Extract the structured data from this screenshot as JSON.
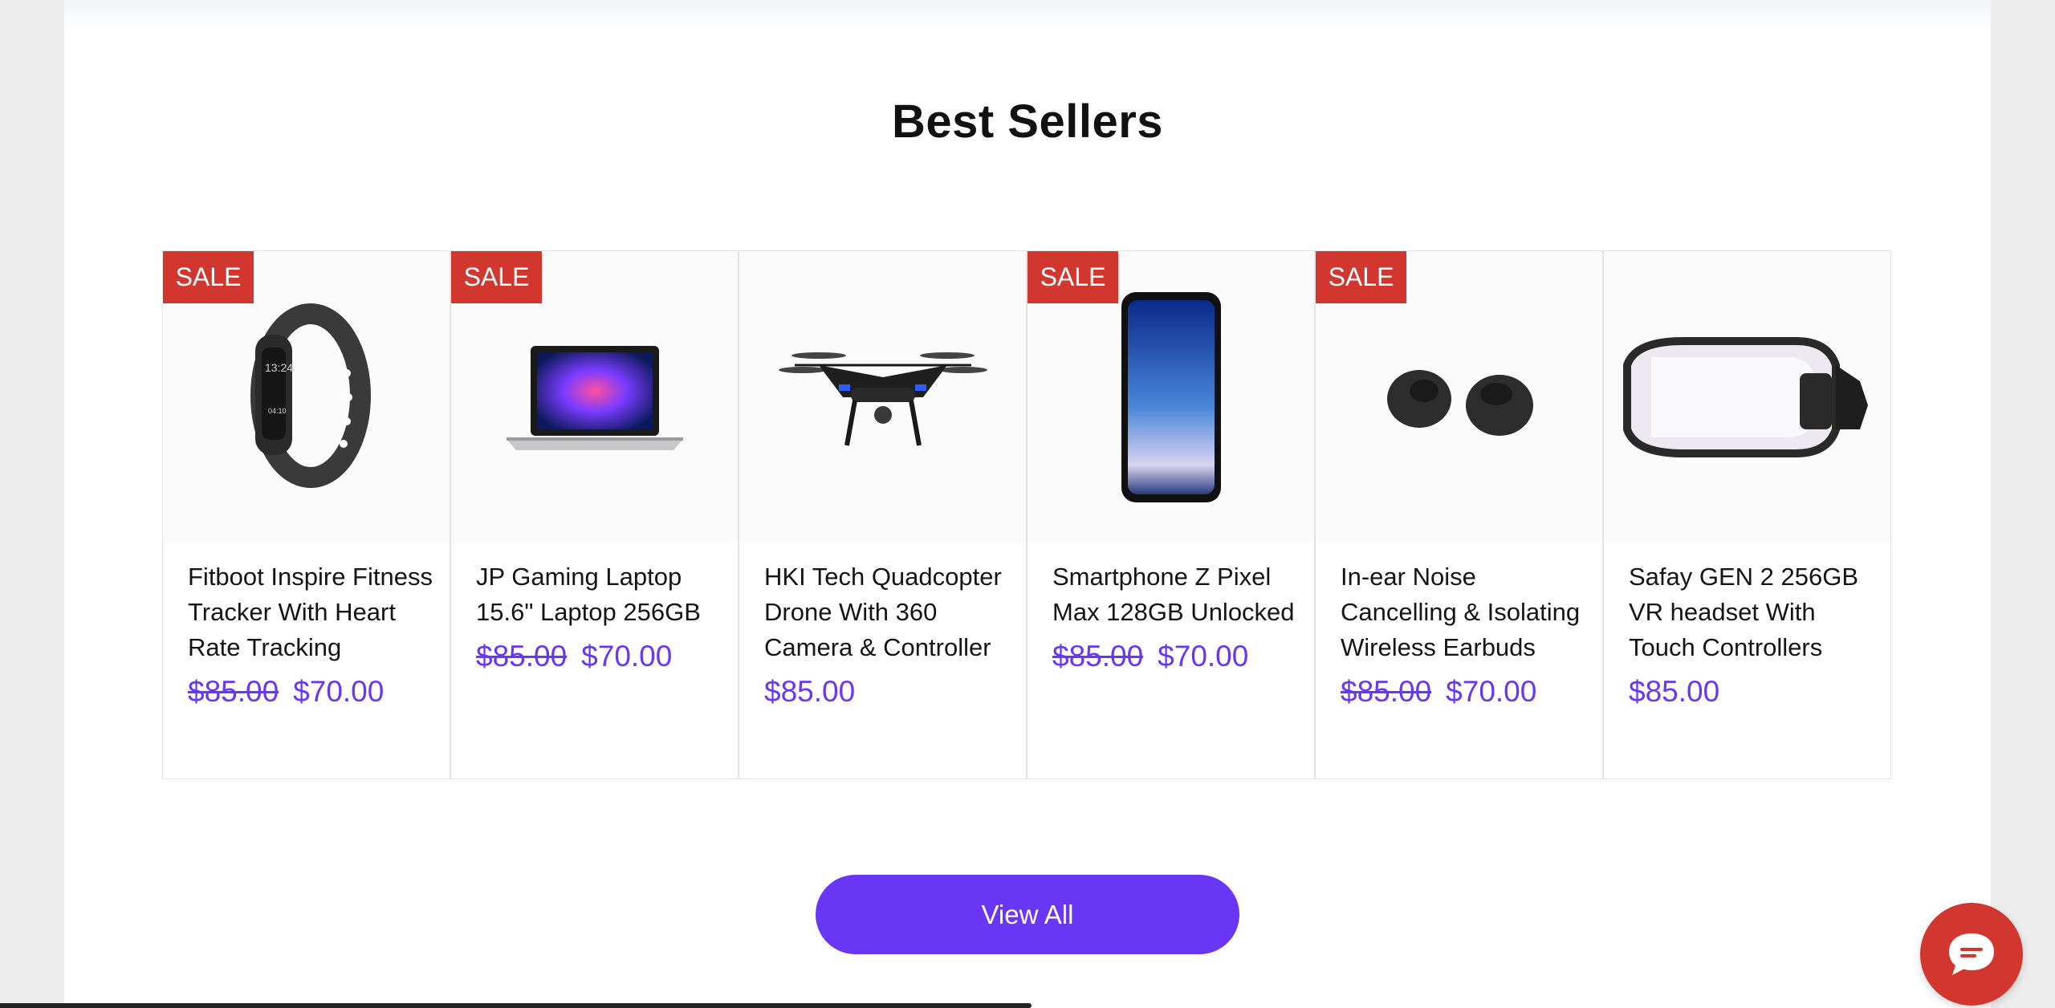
{
  "section": {
    "title": "Best Sellers"
  },
  "products": [
    {
      "badge": "SALE",
      "name": "Fitboot Inspire Fitness Tracker With Heart Rate Tracking",
      "old_price": "$85.00",
      "price": "$70.00",
      "icon": "fitness-tracker-image"
    },
    {
      "badge": "SALE",
      "name": "JP Gaming Laptop 15.6\" Laptop 256GB",
      "old_price": "$85.00",
      "price": "$70.00",
      "icon": "laptop-image"
    },
    {
      "badge": "",
      "name": "HKI Tech Quadcopter Drone With 360 Camera & Controller",
      "old_price": "",
      "price": "$85.00",
      "icon": "drone-image"
    },
    {
      "badge": "SALE",
      "name": "Smartphone Z Pixel Max 128GB Unlocked",
      "old_price": "$85.00",
      "price": "$70.00",
      "icon": "smartphone-image"
    },
    {
      "badge": "SALE",
      "name": "In-ear Noise Cancelling & Isolating Wireless Earbuds",
      "old_price": "$85.00",
      "price": "$70.00",
      "icon": "earbuds-image"
    },
    {
      "badge": "",
      "name": "Safay GEN 2 256GB VR headset With Touch Controllers",
      "old_price": "",
      "price": "$85.00",
      "icon": "vr-headset-image"
    }
  ],
  "actions": {
    "view_all_label": "View All"
  },
  "colors": {
    "accent": "#6a36f5",
    "sale": "#d2372f",
    "chat": "#d2372f"
  },
  "chat": {
    "icon": "chat-bubble-icon"
  }
}
